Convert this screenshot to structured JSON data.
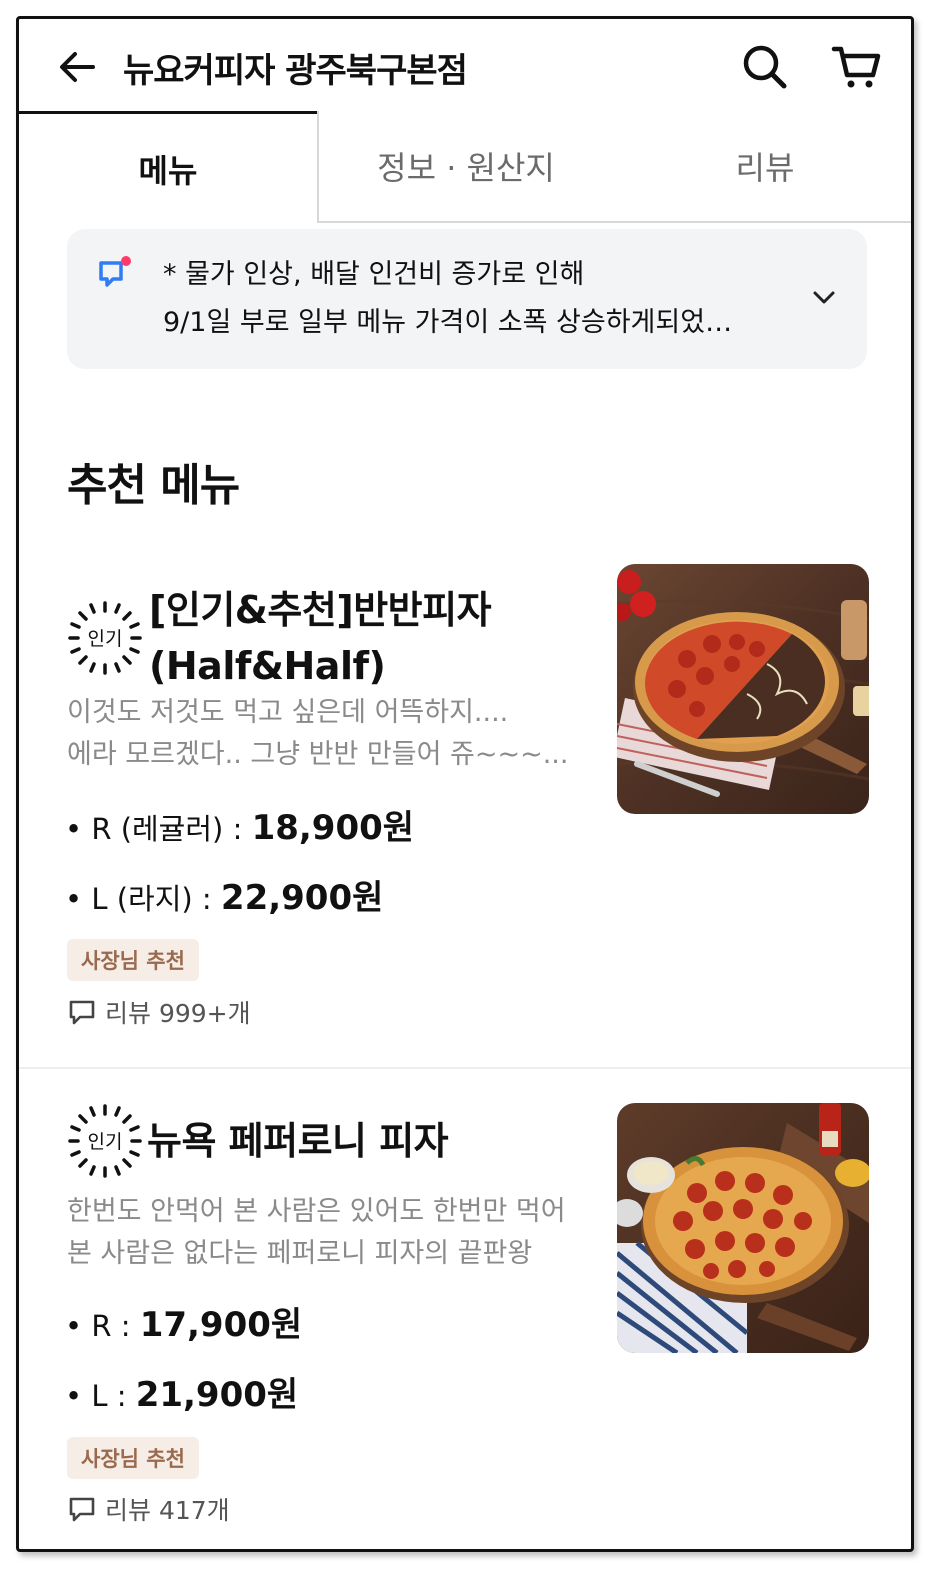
{
  "header": {
    "title": "뉴요커피자 광주북구본점"
  },
  "tabs": [
    {
      "label": "메뉴",
      "active": true
    },
    {
      "label": "정보 · 원산지",
      "active": false
    },
    {
      "label": "리뷰",
      "active": false
    }
  ],
  "notice": {
    "line1": "* 물가 인상, 배달 인건비 증가로 인해",
    "line2": "9/1일 부로 일부 메뉴 가격이 소폭 상승하게되었…"
  },
  "section_title": "추천 메뉴",
  "menu_items": [
    {
      "badge": "인기",
      "name_line1": "[인기&추천]반반피자",
      "name_line2": "(Half&Half)",
      "desc_line1": "이것도 저것도 먹고 싶은데 어뜩하지....",
      "desc_line2": "에라 모르겠다.. 그냥 반반 만들어 쥬~~~...",
      "prices": [
        {
          "label": "• R (레귤러) : ",
          "price": "18,900원"
        },
        {
          "label": "• L (라지) : ",
          "price": "22,900원"
        }
      ],
      "chip": "사장님 추천",
      "reviews": "리뷰 999+개"
    },
    {
      "badge": "인기",
      "name_line1": "뉴욕 페퍼로니 피자",
      "desc_line1": "한번도 안먹어 본 사람은 있어도 한번만 먹어",
      "desc_line2": "본 사람은 없다는 페퍼로니 피자의 끝판왕",
      "prices": [
        {
          "label": "• R : ",
          "price": "17,900원"
        },
        {
          "label": "• L : ",
          "price": "21,900원"
        }
      ],
      "chip": "사장님 추천",
      "reviews": "리뷰 417개"
    }
  ],
  "colors": {
    "notice_bg": "#f3f4f6",
    "accent_blue": "#2f7cf6",
    "accent_pink": "#ff3b6b",
    "chip_bg": "#f6ede6",
    "chip_text": "#9a6a4e"
  }
}
